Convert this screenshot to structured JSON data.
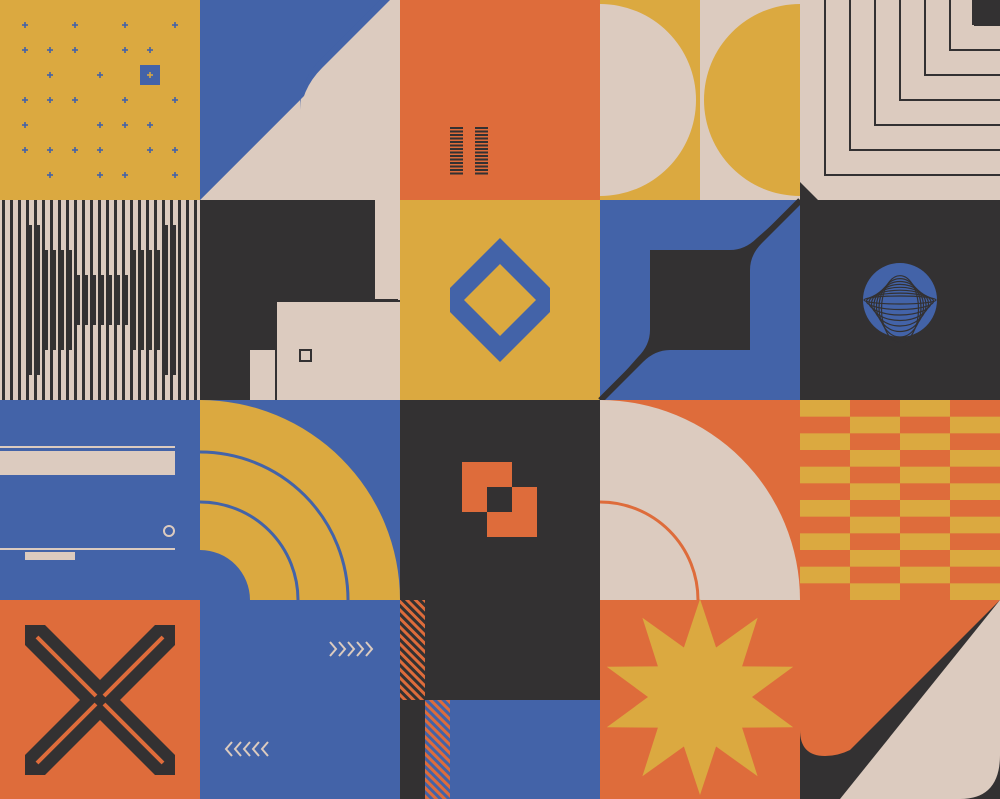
{
  "palette": {
    "mustard": "#dba940",
    "blue": "#4363a8",
    "orange": "#de6c3b",
    "cream": "#dccbbf",
    "charcoal": "#333132"
  },
  "grid": {
    "columns": 5,
    "rows": 4
  },
  "tiles": [
    {
      "name": "tile-plus-pattern",
      "motif": "plus-grid"
    },
    {
      "name": "tile-diagonal-split",
      "motif": "diagonal"
    },
    {
      "name": "tile-barcode-bars",
      "motif": "bars"
    },
    {
      "name": "tile-half-circles",
      "motif": "half-circles"
    },
    {
      "name": "tile-nested-steps",
      "motif": "steps"
    },
    {
      "name": "tile-vertical-stripes",
      "motif": "stripes"
    },
    {
      "name": "tile-stair-blocks",
      "motif": "stairs"
    },
    {
      "name": "tile-rotated-diamond",
      "motif": "diamond"
    },
    {
      "name": "tile-notched-square",
      "motif": "notch"
    },
    {
      "name": "tile-ringed-sphere",
      "motif": "sphere"
    },
    {
      "name": "tile-slider-lines",
      "motif": "lines"
    },
    {
      "name": "tile-rainbow-arcs",
      "motif": "arcs"
    },
    {
      "name": "tile-offset-squares",
      "motif": "squares"
    },
    {
      "name": "tile-quarter-arc",
      "motif": "quarter"
    },
    {
      "name": "tile-checker-pattern",
      "motif": "checker"
    },
    {
      "name": "tile-x-cross",
      "motif": "x-cross"
    },
    {
      "name": "tile-chevron-arrows",
      "motif": "chevrons"
    },
    {
      "name": "tile-hatched-columns",
      "motif": "hatch"
    },
    {
      "name": "tile-starburst",
      "motif": "star"
    },
    {
      "name": "tile-rounded-diagonal",
      "motif": "rounded-diag"
    }
  ]
}
